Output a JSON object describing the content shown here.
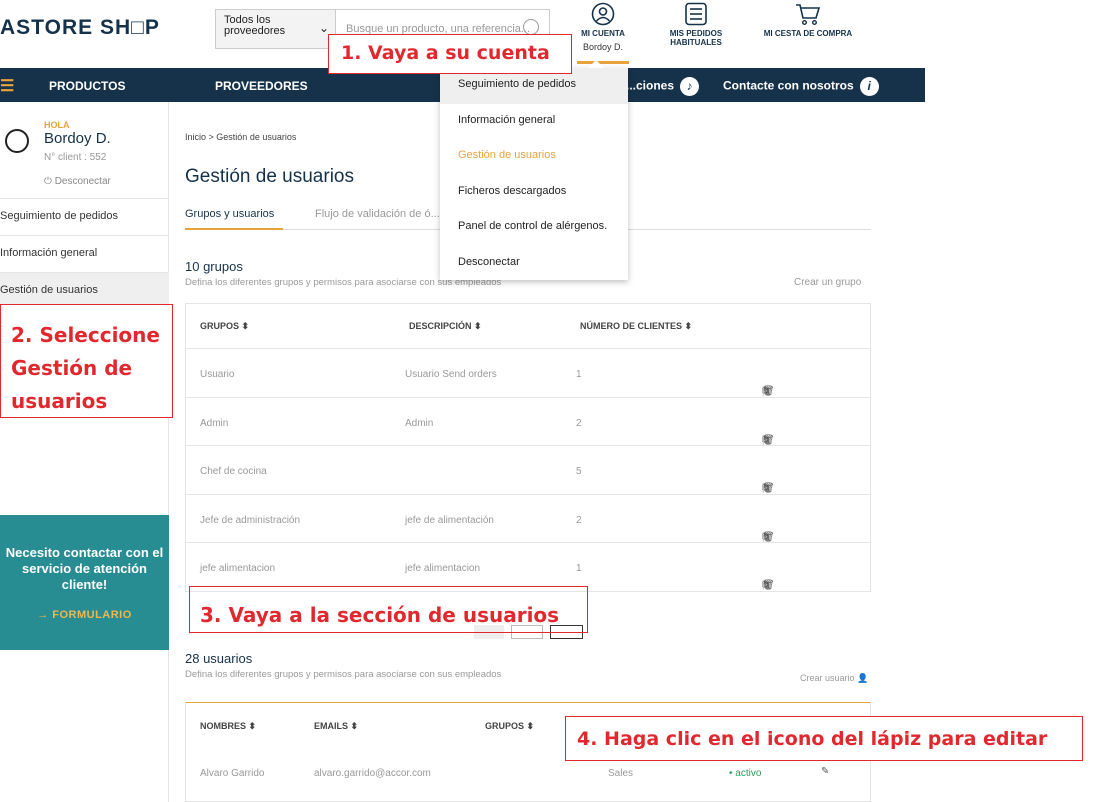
{
  "header": {
    "logo": "ASTORE SH□P",
    "supplier_select": "Todos los proveedores",
    "search_placeholder": "Busque un producto, una referencia...",
    "account_label": "MI CUENTA",
    "account_user": "Bordoy D.",
    "orders_label": "MIS PEDIDOS HABITUALES",
    "cart_label": "MI CESTA DE COMPRA"
  },
  "nav": {
    "products": "PRODUCTOS",
    "suppliers": "PROVEEDORES",
    "notifications": "...ciones",
    "contact": "Contacte con nosotros"
  },
  "dropdown": {
    "items": [
      "Seguimiento de pedidos",
      "Información general",
      "Gestión de usuarios",
      "Ficheros descargados",
      "Panel de control de alérgenos.",
      "Desconectar"
    ],
    "active_index": 2
  },
  "sidebar": {
    "greeting": "HOLA",
    "user_name": "Bordoy D.",
    "client_number": "N° client : 552",
    "logout": "Desconectar",
    "links": [
      "Seguimiento de pedidos",
      "Información general",
      "Gestión de usuarios"
    ],
    "contact_text": "Necesito contactar con el servicio de atención cliente!",
    "contact_link": "→ FORMULARIO"
  },
  "main": {
    "breadcrumb_home": "Inicio",
    "breadcrumb_current": "Gestión de usuarios",
    "title": "Gestión de usuarios",
    "tabs": [
      "Grupos y usuarios",
      "Flujo de validación de ó..."
    ],
    "groups": {
      "title": "10 grupos",
      "subtitle": "Defina los diferentes grupos y permisos para asociarse con sus empleados",
      "create": "Crear un grupo",
      "headers": [
        "GRUPOS ⬍",
        "DESCRIPCIÓN ⬍",
        "NÚMERO DE CLIENTES ⬍"
      ],
      "rows": [
        {
          "name": "Usuario",
          "desc": "Usuario Send orders",
          "count": "1"
        },
        {
          "name": "Admin",
          "desc": "Admin",
          "count": "2"
        },
        {
          "name": "Chef de cocina",
          "desc": "",
          "count": "5"
        },
        {
          "name": "Jefe de administración",
          "desc": "jefe de alimentación",
          "count": "2"
        },
        {
          "name": "jefe alimentacion",
          "desc": "jefe alimentacion",
          "count": "1"
        }
      ]
    },
    "users": {
      "title": "28 usuarios",
      "subtitle": "Defina los diferentes grupos y permisos para asociarse con sus empleados",
      "create": "Crear usuario",
      "headers": [
        "NOMBRES ⬍",
        "EMAILS ⬍",
        "GRUPOS ⬍"
      ],
      "row": {
        "name": "Alvaro Garrido",
        "email": "alvaro.garrido@accor.com",
        "group": "Sales",
        "status": "• activo"
      }
    }
  },
  "annotations": {
    "step1": "1. Vaya a su cuenta",
    "step2": "2. Seleccione Gestión de usuarios",
    "step3": "3. Vaya a la sección de usuarios",
    "step4": "4. Haga clic en el icono del lápiz para editar"
  },
  "colors": {
    "navy": "#16324a",
    "accent": "#e8a33c",
    "teal": "#278d93",
    "annotation_red": "#e0282e"
  }
}
